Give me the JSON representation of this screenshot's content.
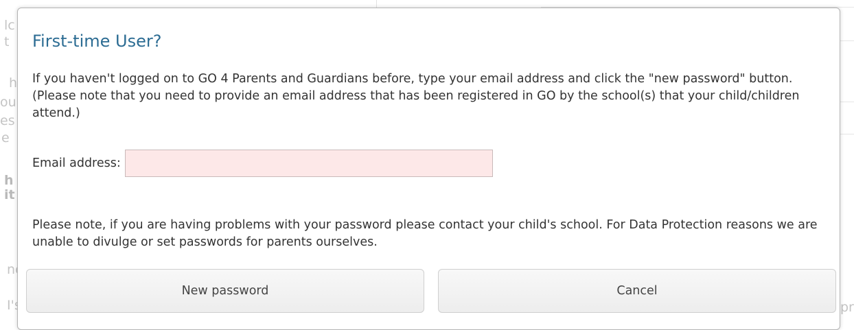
{
  "background": {
    "fragments": [
      "lc",
      "t",
      "h",
      "ou",
      "es",
      "e",
      "h",
      "it",
      "nc",
      "I's",
      "pr"
    ]
  },
  "dialog": {
    "title": "First-time User?",
    "intro_text": "If you haven't logged on to GO 4 Parents and Guardians before, type your email address and click the \"new password\" button. (Please note that you need to provide an email address that has been registered in GO by the school(s) that your child/children attend.)",
    "email_label": "Email address:",
    "email_value": "",
    "note_text": "Please note, if you are having problems with your password please contact your child's school. For Data Protection reasons we are unable to divulge or set passwords for parents ourselves.",
    "new_password_label": "New password",
    "cancel_label": "Cancel"
  },
  "colors": {
    "title": "#2c6c93",
    "input_background": "#fde8e8"
  }
}
